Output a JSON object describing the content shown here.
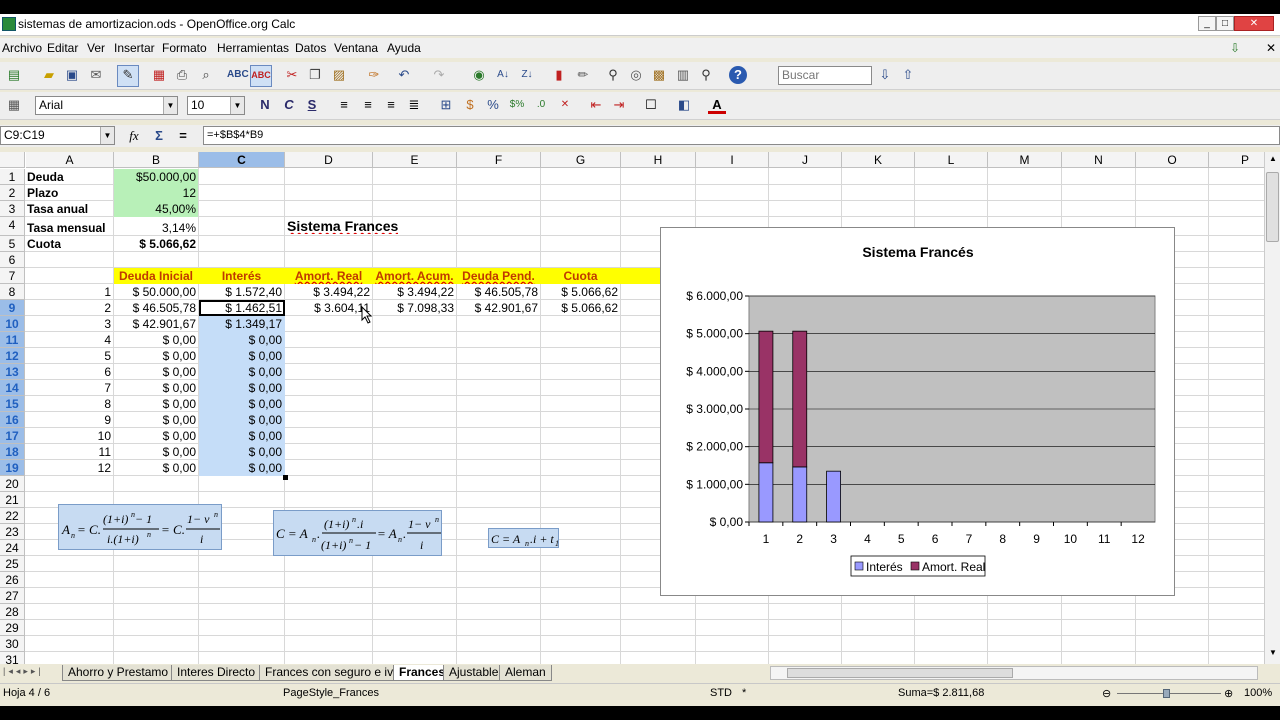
{
  "window": {
    "title": "sistemas de amortizacion.ods - OpenOffice.org Calc"
  },
  "menu": [
    "Archivo",
    "Editar",
    "Ver",
    "Insertar",
    "Formato",
    "Herramientas",
    "Datos",
    "Ventana",
    "Ayuda"
  ],
  "toolbar": {
    "search_placeholder": "Buscar"
  },
  "format": {
    "font": "Arial",
    "size": "10"
  },
  "formula_bar": {
    "name_box": "C9:C19",
    "formula": "=+$B$4*B9"
  },
  "columns": [
    "A",
    "B",
    "C",
    "D",
    "E",
    "F",
    "G",
    "H",
    "I",
    "J",
    "K",
    "L",
    "M",
    "N",
    "O",
    "P"
  ],
  "rows": [
    "1",
    "2",
    "3",
    "4",
    "5",
    "6",
    "7",
    "8",
    "9",
    "10",
    "11",
    "12",
    "13",
    "14",
    "15",
    "16",
    "17",
    "18",
    "19",
    "20",
    "21",
    "22",
    "23",
    "24",
    "25",
    "26",
    "27",
    "28",
    "29",
    "30",
    "31"
  ],
  "cells": {
    "a1": "Deuda",
    "b1": "$50.000,00",
    "a2": "Plazo",
    "b2": "12",
    "a3": "Tasa anual",
    "b3": "45,00%",
    "a4": "Tasa mensual",
    "b4": "3,14%",
    "d4": "Sistema Frances",
    "a5": "Cuota",
    "b5": "$ 5.066,62",
    "b7": "Deuda Inicial",
    "c7": "Interés",
    "d7": "Amort. Real",
    "e7": "Amort. Acum.",
    "f7": "Deuda Pend.",
    "g7": "Cuota",
    "a8": "1",
    "b8": "$ 50.000,00",
    "c8": "$ 1.572,40",
    "d8": "$ 3.494,22",
    "e8": "$ 3.494,22",
    "f8": "$ 46.505,78",
    "g8": "$ 5.066,62",
    "a9": "2",
    "b9": "$ 46.505,78",
    "c9": "$ 1.462,51",
    "d9": "$ 3.604,11",
    "e9": "$ 7.098,33",
    "f9": "$ 42.901,67",
    "g9": "$ 5.066,62",
    "a10": "3",
    "b10": "$ 42.901,67",
    "c10": "$ 1.349,17",
    "a11": "4",
    "b11": "$ 0,00",
    "c11": "$ 0,00",
    "a12": "5",
    "b12": "$ 0,00",
    "c12": "$ 0,00",
    "a13": "6",
    "b13": "$ 0,00",
    "c13": "$ 0,00",
    "a14": "7",
    "b14": "$ 0,00",
    "c14": "$ 0,00",
    "a15": "8",
    "b15": "$ 0,00",
    "c15": "$ 0,00",
    "a16": "9",
    "b16": "$ 0,00",
    "c16": "$ 0,00",
    "a17": "10",
    "b17": "$ 0,00",
    "c17": "$ 0,00",
    "a18": "11",
    "b18": "$ 0,00",
    "c18": "$ 0,00",
    "a19": "12",
    "b19": "$ 0,00",
    "c19": "$ 0,00"
  },
  "formulas": {
    "f1": {
      "lhs": "A",
      "sub": "n",
      "eq1": "= C.",
      "num1": "(1+i)",
      "num1sup": "n",
      "num1tail": " − 1",
      "den1": "i.(1+i)",
      "den1sup": "n",
      "eq2": "= C.",
      "num2": "1− v",
      "num2sup": "n",
      "den2": "i"
    },
    "f2": {
      "lhs": "C = A",
      "sub": "n",
      "dot": ".",
      "num1": "(1+i)",
      "num1sup": "n",
      "num1tail": ".i",
      "den1": "(1+i)",
      "den1sup": "n",
      "den1tail": " − 1",
      "eq2": "= A",
      "sub2": "n",
      "dot2": ".",
      "num2": "1− v",
      "num2sup": "n",
      "den2": "i"
    },
    "f3": {
      "text": "C = A",
      "sub": "n",
      "mid": ".i + t",
      "sub2": "1"
    }
  },
  "chart_data": {
    "type": "bar",
    "stacked": true,
    "title": "Sistema Francés",
    "categories": [
      "1",
      "2",
      "3",
      "4",
      "5",
      "6",
      "7",
      "8",
      "9",
      "10",
      "11",
      "12"
    ],
    "series": [
      {
        "name": "Interés",
        "color": "#9999ff",
        "values": [
          1572.4,
          1462.51,
          1349.17,
          0,
          0,
          0,
          0,
          0,
          0,
          0,
          0,
          0
        ]
      },
      {
        "name": "Amort. Real",
        "color": "#993366",
        "values": [
          3494.22,
          3604.11,
          0,
          0,
          0,
          0,
          0,
          0,
          0,
          0,
          0,
          0
        ]
      }
    ],
    "yticks": [
      "$ 0,00",
      "$ 1.000,00",
      "$ 2.000,00",
      "$ 3.000,00",
      "$ 4.000,00",
      "$ 5.000,00",
      "$ 6.000,00"
    ],
    "ylim": [
      0,
      6000
    ],
    "legend": "bottom",
    "plot_bg": "#c0c0c0"
  },
  "sheet_tabs": [
    "Ahorro y Prestamo",
    "Interes Directo",
    "Frances con seguro e iva",
    "Frances",
    "Ajustable",
    "Aleman"
  ],
  "active_tab": "Frances",
  "status": {
    "sheet": "Hoja 4 / 6",
    "pagestyle": "PageStyle_Frances",
    "mode": "STD",
    "modified": "*",
    "sum": "Suma=$ 2.811,68",
    "zoom": "100%"
  }
}
